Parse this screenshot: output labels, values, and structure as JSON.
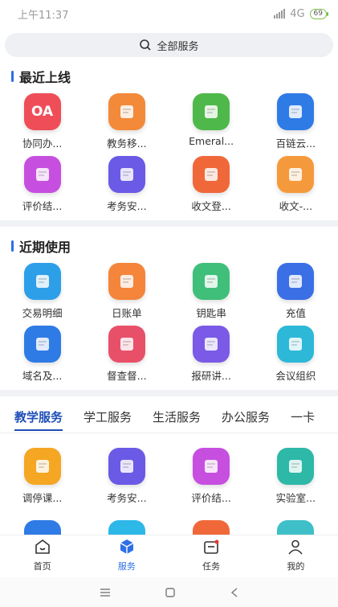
{
  "status_bar": {
    "time": "上午11:37",
    "network": "4G",
    "battery": "69"
  },
  "search": {
    "label": "全部服务"
  },
  "recent_online": {
    "title": "最近上线",
    "items": [
      {
        "label": "协同办...",
        "icon": "oa-icon",
        "glyph": "OA",
        "color": "#ef4e58"
      },
      {
        "label": "教务移...",
        "icon": "books-icon",
        "glyph": "",
        "color": "#f28a3a"
      },
      {
        "label": "Emeral...",
        "icon": "document-search-icon",
        "glyph": "",
        "color": "#4fb84a"
      },
      {
        "label": "百链云...",
        "icon": "book-search-icon",
        "glyph": "",
        "color": "#2f7be6"
      },
      {
        "label": "评价结...",
        "icon": "hand-card-icon",
        "glyph": "",
        "color": "#c64fe0"
      },
      {
        "label": "考务安...",
        "icon": "monitor-clock-icon",
        "glyph": "",
        "color": "#6a5ae6"
      },
      {
        "label": "收文登...",
        "icon": "inbox-register-icon",
        "glyph": "",
        "color": "#f0683a"
      },
      {
        "label": "收文-...",
        "icon": "doc-edit-icon",
        "glyph": "",
        "color": "#f59a3c"
      }
    ]
  },
  "recent_used": {
    "title": "近期使用",
    "items": [
      {
        "label": "交易明细",
        "icon": "transaction-card-icon",
        "glyph": "",
        "color": "#2d9fe8"
      },
      {
        "label": "日账单",
        "icon": "bill-edit-icon",
        "glyph": "",
        "color": "#f4853a"
      },
      {
        "label": "钥匙串",
        "icon": "badge-ribbon-icon",
        "glyph": "",
        "color": "#3fbf7a"
      },
      {
        "label": "充值",
        "icon": "card-add-icon",
        "glyph": "",
        "color": "#3a6fe6"
      },
      {
        "label": "域名及...",
        "icon": "globe-ip-icon",
        "glyph": "",
        "color": "#2f7be6"
      },
      {
        "label": "督查督...",
        "icon": "report-check-icon",
        "glyph": "",
        "color": "#e8506a"
      },
      {
        "label": "报研讲...",
        "icon": "paper-scroll-icon",
        "glyph": "",
        "color": "#7a5ae6"
      },
      {
        "label": "会议组织",
        "icon": "meeting-board-icon",
        "glyph": "",
        "color": "#2db8d8"
      }
    ]
  },
  "tabs": [
    "教学服务",
    "学工服务",
    "生活服务",
    "办公服务",
    "一卡"
  ],
  "teaching_services": [
    {
      "label": "调停课...",
      "icon": "calendar-swap-icon",
      "color": "#f5a623"
    },
    {
      "label": "考务安...",
      "icon": "monitor-clock-icon",
      "color": "#6a5ae6"
    },
    {
      "label": "评价结...",
      "icon": "hand-card-icon",
      "color": "#c64fe0"
    },
    {
      "label": "实验室...",
      "icon": "flask-icon",
      "color": "#2db8a8"
    }
  ],
  "bottom_nav": [
    {
      "label": "首页",
      "icon": "home-icon"
    },
    {
      "label": "服务",
      "icon": "cube-icon"
    },
    {
      "label": "任务",
      "icon": "task-icon"
    },
    {
      "label": "我的",
      "icon": "user-icon"
    }
  ]
}
